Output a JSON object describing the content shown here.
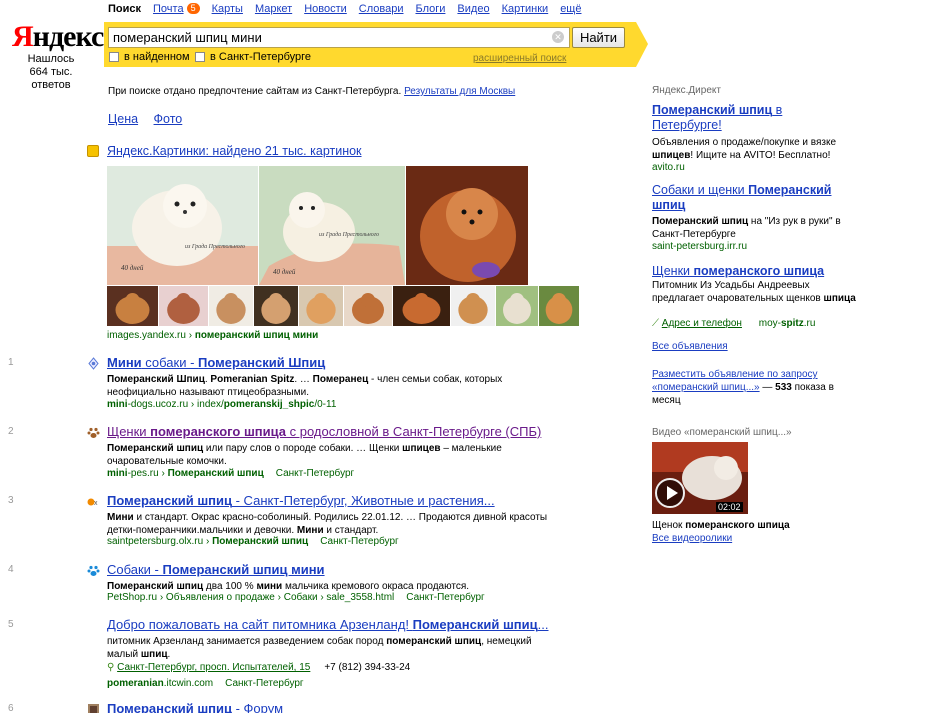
{
  "logo": "Яндекс",
  "found": {
    "line1": "Нашлось",
    "line2": "664 тыс. ответов"
  },
  "services": [
    {
      "label": "Поиск",
      "active": true
    },
    {
      "label": "Почта",
      "badge": "5"
    },
    {
      "label": "Карты"
    },
    {
      "label": "Маркет"
    },
    {
      "label": "Новости"
    },
    {
      "label": "Словари"
    },
    {
      "label": "Блоги"
    },
    {
      "label": "Видео"
    },
    {
      "label": "Картинки"
    },
    {
      "label": "ещё"
    }
  ],
  "search": {
    "query": "померанский шпиц мини",
    "button": "Найти",
    "in_found": "в найденном",
    "in_region": "в Санкт-Петербурге",
    "advanced": "расширенный поиск"
  },
  "preference": {
    "text": "При поиске отдано предпочтение сайтам из Санкт-Петербурга.",
    "link": "Результаты для Москвы"
  },
  "tabs": [
    "Цена",
    "Фото"
  ],
  "images": {
    "title": "Яндекс.Картинки: найдено 21 тыс. картинок",
    "url_host": "images.yandex.ru",
    "url_sep": " › ",
    "url_query": "померанский шпиц мини",
    "caption1": "40 дней",
    "caption2": "40 дней",
    "watermark1": "из Града Престольного",
    "watermark2": "из Града Престольного"
  },
  "results": [
    {
      "num": "1",
      "title": [
        {
          "t": "Мини",
          "b": true
        },
        {
          "t": " собаки - "
        },
        {
          "t": "Померанский Шпиц",
          "b": true
        }
      ],
      "snippet": [
        {
          "t": "Померанский Шпиц",
          "b": true
        },
        {
          "t": ". "
        },
        {
          "t": "Pomeranian Spitz",
          "b": true
        },
        {
          "t": ". … "
        },
        {
          "t": "Померанец",
          "b": true
        },
        {
          "t": " - член семьи собак, которых неофициально называют птицеобразными."
        }
      ],
      "url": [
        {
          "t": "mini",
          "b": true
        },
        {
          "t": "-dogs.ucoz.ru › index/"
        },
        {
          "t": "pomeranskij_shpic",
          "b": true
        },
        {
          "t": "/0-11"
        }
      ],
      "region": ""
    },
    {
      "num": "2",
      "title": [
        {
          "t": "Щенки "
        },
        {
          "t": "померанского шпица",
          "b": true
        },
        {
          "t": " с родословной в Санкт-Петербурге (СПБ)"
        }
      ],
      "snippet": [
        {
          "t": "Померанский шпиц",
          "b": true
        },
        {
          "t": " или пару слов о породе собаки. … Щенки "
        },
        {
          "t": "шпицев",
          "b": true
        },
        {
          "t": " – маленькие очаровательные комочки."
        }
      ],
      "url": [
        {
          "t": "mini",
          "b": true
        },
        {
          "t": "-pes.ru › "
        },
        {
          "t": "Померанский шпиц",
          "b": true
        }
      ],
      "region": "Санкт-Петербург"
    },
    {
      "num": "3",
      "title": [
        {
          "t": "Померанский шпиц",
          "b": true
        },
        {
          "t": " - Санкт-Петербург, Животные и растения..."
        }
      ],
      "snippet": [
        {
          "t": "Мини",
          "b": true
        },
        {
          "t": " и стандарт. Окрас красно-соболиный. Родились 22.01.12. … Продаются дивной красоты детки-померанчики.мальчики и девочки. "
        },
        {
          "t": "Мини",
          "b": true
        },
        {
          "t": " и стандарт."
        }
      ],
      "url": [
        {
          "t": "saintpetersburg.olx.ru › "
        },
        {
          "t": "Померанский шпиц",
          "b": true
        }
      ],
      "region": "Санкт-Петербург"
    },
    {
      "num": "4",
      "title": [
        {
          "t": "Собаки - "
        },
        {
          "t": "Померанский шпиц мини",
          "b": true
        }
      ],
      "snippet": [
        {
          "t": "Померанский шпиц",
          "b": true
        },
        {
          "t": " два 100 % "
        },
        {
          "t": "мини",
          "b": true
        },
        {
          "t": " мальчика кремового окраса продаются."
        }
      ],
      "url": [
        {
          "t": "PetShop.ru › Объявления о продаже › Собаки › sale_3558.html"
        }
      ],
      "region": "Санкт-Петербург"
    },
    {
      "num": "5",
      "title": [
        {
          "t": "Добро пожаловать на сайт питомника Арзенланд! "
        },
        {
          "t": "Померанский шпиц",
          "b": true
        },
        {
          "t": "..."
        }
      ],
      "snippet": [
        {
          "t": "питомник Арзенланд занимается разведением собак пород "
        },
        {
          "t": "померанский шпиц",
          "b": true
        },
        {
          "t": ", немецкий малый "
        },
        {
          "t": "шпиц",
          "b": true
        },
        {
          "t": "."
        }
      ],
      "address": "Санкт-Петербург, просп. Испытателей, 15",
      "phone": "+7 (812) 394-33-24",
      "url": [
        {
          "t": "pomeranian",
          "b": true
        },
        {
          "t": ".itcwin.com"
        }
      ],
      "region": "Санкт-Петербург"
    },
    {
      "num": "6",
      "title": [
        {
          "t": "Померанский шпиц",
          "b": true
        },
        {
          "t": " - Форум"
        }
      ]
    }
  ],
  "direct": {
    "heading": "Яндекс.Директ",
    "ads": [
      {
        "title": [
          {
            "t": "Померанский шпиц",
            "b": true
          },
          {
            "t": " в Петербурге!"
          }
        ],
        "text": [
          {
            "t": "Объявления о продаже/покупке и вязке "
          },
          {
            "t": "шпицев",
            "b": true
          },
          {
            "t": "! Ищите на AVITO! Бесплатно!"
          }
        ],
        "url": "avito.ru"
      },
      {
        "title": [
          {
            "t": "Собаки и щенки "
          },
          {
            "t": "Померанский шпиц",
            "b": true
          }
        ],
        "text": [
          {
            "t": "Померанский шпиц",
            "b": true
          },
          {
            "t": " на \"Из рук в руки\" в Санкт-Петербурге"
          }
        ],
        "url": "saint-petersburg.irr.ru"
      },
      {
        "title": [
          {
            "t": "Щенки "
          },
          {
            "t": "померанского шпица",
            "b": true
          }
        ],
        "text": [
          {
            "t": "Питомник Из Усадьбы Андреевых предлагает очаровательных щенков "
          },
          {
            "t": "шпица",
            "b": true
          }
        ],
        "address": "Адрес и телефон",
        "url_pre": "moy-",
        "url_bold": "spitz",
        "url_post": ".ru"
      }
    ],
    "all_ads": "Все объявления",
    "place_ad": "Разместить объявление по запросу «померанский шпиц...»",
    "place_ad_stat_pre": " — ",
    "place_ad_count": "533",
    "place_ad_stat_post": " показа в месяц"
  },
  "video": {
    "heading": "Видео «померанский шпиц...»",
    "duration": "02:02",
    "caption_pre": "Щенок ",
    "caption_bold": "померанского шпица",
    "all": "Все видеоролики"
  },
  "colors": {
    "accent": "#ffd92e",
    "link": "#1a3dc1",
    "url_green": "#006000",
    "logo_red": "#ff0000"
  }
}
